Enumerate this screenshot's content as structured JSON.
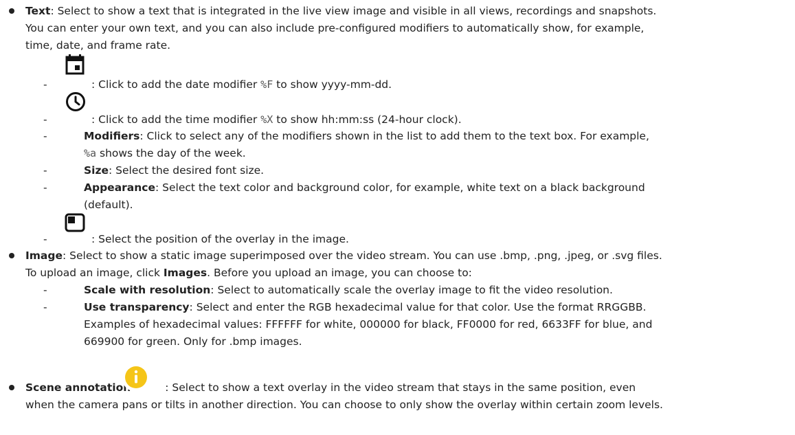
{
  "text_item": {
    "term": "Text",
    "line1": ": Select to show a text that is integrated in the live view image and visible in all views, recordings and snapshots.",
    "line2": "You can enter your own text, and you can also include pre-configured modifiers to automatically show, for example,",
    "line3": "time, date, and frame rate.",
    "sub": {
      "date_pre": ": Click to add the date modifier ",
      "date_code": "%F",
      "date_post": " to show yyyy-mm-dd.",
      "time_pre": ": Click to add the time modifier ",
      "time_code": "%X",
      "time_post": " to show hh:mm:ss (24-hour clock).",
      "modifiers_term": "Modifiers",
      "modifiers_line1": ": Click to select any of the modifiers shown in the list to add them to the text box. For example,",
      "modifiers_code": "%a",
      "modifiers_line2": " shows the day of the week.",
      "size_term": "Size",
      "size_text": ": Select the desired font size.",
      "appearance_term": "Appearance",
      "appearance_line1": ": Select the text color and background color, for example, white text on a black background",
      "appearance_line2": "(default).",
      "position_text": ": Select the position of the overlay in the image."
    }
  },
  "image_item": {
    "term": "Image",
    "line1": ": Select to show a static image superimposed over the video stream. You can use .bmp, .png, .jpeg, or .svg files.",
    "line2_pre": "To upload an image, click ",
    "line2_term": "Images",
    "line2_post": ". Before you upload an image, you can choose to:",
    "sub": {
      "scale_term": "Scale with resolution",
      "scale_text": ": Select to automatically scale the overlay image to fit the video resolution.",
      "transp_term": "Use transparency",
      "transp_line1": ": Select and enter the RGB hexadecimal value for that color. Use the format RRGGBB.",
      "transp_line2": "Examples of hexadecimal values: FFFFFF for white, 000000 for black, FF0000 for red, 6633FF for blue, and",
      "transp_line3": "669900 for green. Only for .bmp images."
    }
  },
  "scene_item": {
    "term": "Scene annotation",
    "line1": ": Select to show a text overlay in the video stream that stays in the same position, even",
    "line2": "when the camera pans or tilts in another direction. You can choose to only show the overlay within certain zoom levels."
  },
  "dash_glyph": "-",
  "icons": {
    "date": "calendar-icon",
    "time": "clock-icon",
    "position": "overlay-position-icon",
    "info": "info-icon"
  },
  "colors": {
    "text": "#222222",
    "info_icon": "#F5C518"
  }
}
